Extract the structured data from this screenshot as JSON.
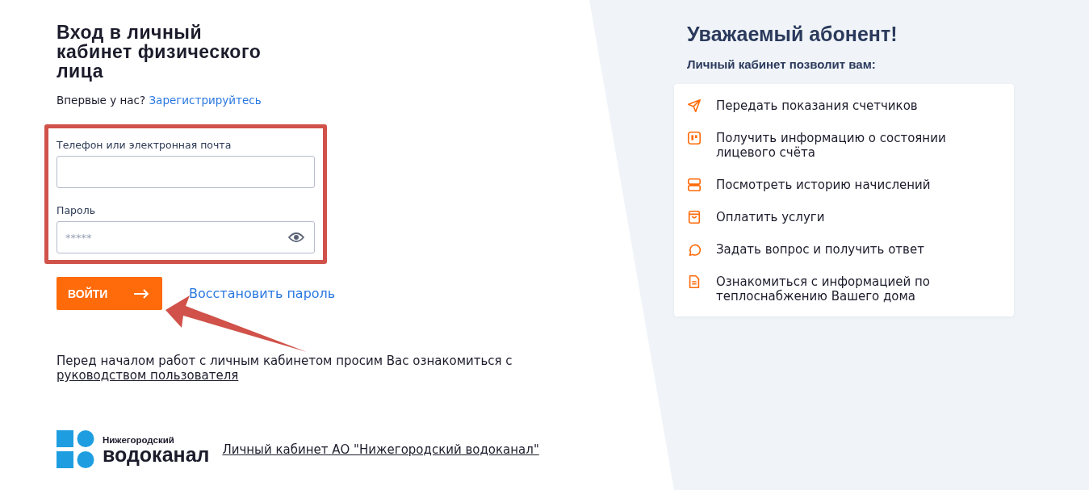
{
  "login": {
    "title": "Вход в личный кабинет физического лица",
    "register_prompt": "Впервые у нас?",
    "register_link": "Зарегистрируйтесь",
    "fields": [
      {
        "label": "Телефон или электронная почта",
        "kind": "text"
      },
      {
        "label": "Пароль",
        "kind": "password",
        "placeholder": "*****"
      }
    ],
    "submit": "ВОЙТИ",
    "restore_link": "Восстановить пароль",
    "notice": "Перед началом работ с личным кабинетом просим Вас ознакомиться с",
    "guide_link": "руководством пользователя",
    "logo": {
      "line1": "Нижегородский",
      "line2": "водоканал"
    },
    "footer_link": "Личный кабинет АО \"Нижегородский водоканал\""
  },
  "benefits": {
    "title": "Уважаемый абонент!",
    "subtitle": "Личный кабинет позволит вам:",
    "items": [
      {
        "kind": "send",
        "text": "Передать показания счетчиков"
      },
      {
        "kind": "board",
        "text": "Получить информацию о состоянии лицевого счёта"
      },
      {
        "kind": "server",
        "text": "Посмотреть историю начислений"
      },
      {
        "kind": "bag",
        "text": "Оплатить услуги"
      },
      {
        "kind": "chat",
        "text": "Задать вопрос и получить ответ"
      },
      {
        "kind": "document",
        "text": "Ознакомиться с информацией по теплоснабжению Вашего дома"
      }
    ]
  }
}
